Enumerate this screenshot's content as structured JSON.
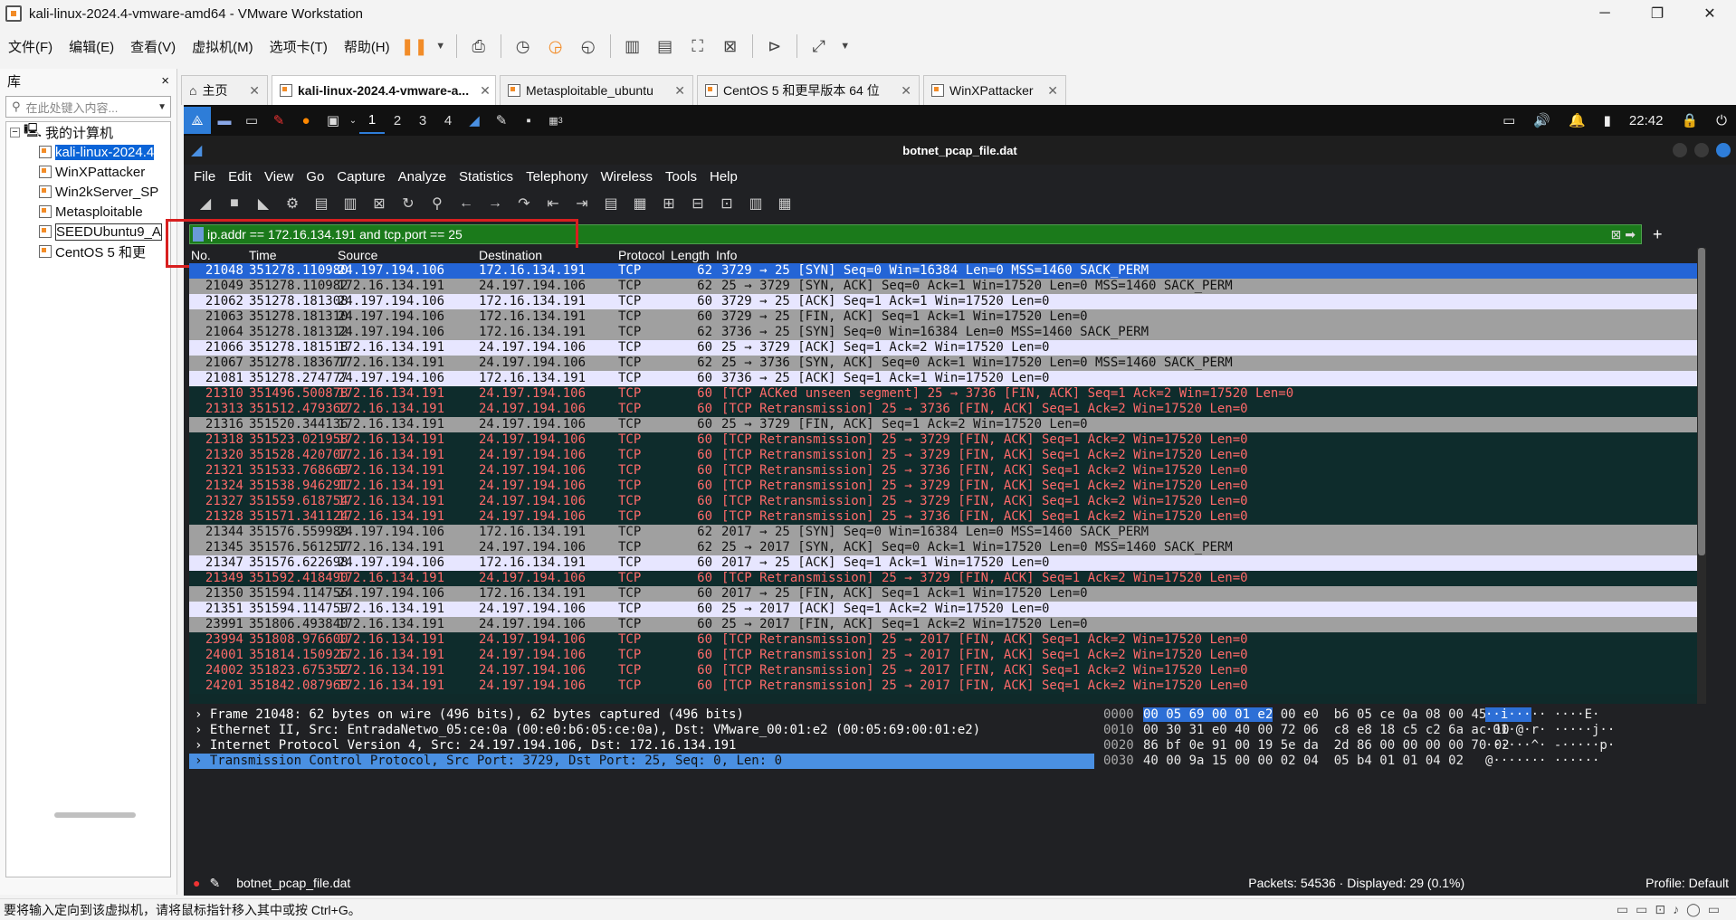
{
  "window": {
    "title": "kali-linux-2024.4-vmware-amd64 - VMware Workstation",
    "min": "─",
    "max": "❐",
    "close": "✕"
  },
  "menubar": {
    "items": [
      "文件(F)",
      "编辑(E)",
      "查看(V)",
      "虚拟机(M)",
      "选项卡(T)",
      "帮助(H)"
    ]
  },
  "library": {
    "title": "库",
    "close": "×",
    "search_placeholder": "在此处键入内容...",
    "root": "我的计算机",
    "vms": [
      "kali-linux-2024.4",
      "WinXPattacker",
      "Win2kServer_SP",
      "Metasploitable",
      "SEEDUbuntu9_A",
      "CentOS 5 和更"
    ]
  },
  "tabs": [
    {
      "label": "主页"
    },
    {
      "label": "kali-linux-2024.4-vmware-a..."
    },
    {
      "label": "Metasploitable_ubuntu"
    },
    {
      "label": "CentOS 5 和更早版本 64 位"
    },
    {
      "label": "WinXPattacker"
    }
  ],
  "kali": {
    "workspaces": [
      "1",
      "2",
      "3",
      "4"
    ],
    "clock": "22:42",
    "badge": "3"
  },
  "wireshark": {
    "title": "botnet_pcap_file.dat",
    "menu": [
      "File",
      "Edit",
      "View",
      "Go",
      "Capture",
      "Analyze",
      "Statistics",
      "Telephony",
      "Wireless",
      "Tools",
      "Help"
    ],
    "filter": "ip.addr == 172.16.134.191 and tcp.port == 25",
    "columns": {
      "no": "No.",
      "time": "Time",
      "source": "Source",
      "destination": "Destination",
      "protocol": "Protocol",
      "length": "Length",
      "info": "Info"
    },
    "packets": [
      {
        "no": "21048",
        "time": "351278.110980",
        "src": "24.197.194.106",
        "dst": "172.16.134.191",
        "proto": "TCP",
        "len": "62",
        "info": "3729 → 25 [SYN] Seq=0 Win=16384 Len=0 MSS=1460 SACK_PERM",
        "style": "sel"
      },
      {
        "no": "21049",
        "time": "351278.110982",
        "src": "172.16.134.191",
        "dst": "24.197.194.106",
        "proto": "TCP",
        "len": "62",
        "info": "25 → 3729 [SYN, ACK] Seq=0 Ack=1 Win=17520 Len=0 MSS=1460 SACK_PERM",
        "style": "syn"
      },
      {
        "no": "21062",
        "time": "351278.181308",
        "src": "24.197.194.106",
        "dst": "172.16.134.191",
        "proto": "TCP",
        "len": "60",
        "info": "3729 → 25 [ACK] Seq=1 Ack=1 Win=17520 Len=0",
        "style": "ack"
      },
      {
        "no": "21063",
        "time": "351278.181310",
        "src": "24.197.194.106",
        "dst": "172.16.134.191",
        "proto": "TCP",
        "len": "60",
        "info": "3729 → 25 [FIN, ACK] Seq=1 Ack=1 Win=17520 Len=0",
        "style": "syn"
      },
      {
        "no": "21064",
        "time": "351278.181312",
        "src": "24.197.194.106",
        "dst": "172.16.134.191",
        "proto": "TCP",
        "len": "62",
        "info": "3736 → 25 [SYN] Seq=0 Win=16384 Len=0 MSS=1460 SACK_PERM",
        "style": "syn"
      },
      {
        "no": "21066",
        "time": "351278.181518",
        "src": "172.16.134.191",
        "dst": "24.197.194.106",
        "proto": "TCP",
        "len": "60",
        "info": "25 → 3729 [ACK] Seq=1 Ack=2 Win=17520 Len=0",
        "style": "ack"
      },
      {
        "no": "21067",
        "time": "351278.183677",
        "src": "172.16.134.191",
        "dst": "24.197.194.106",
        "proto": "TCP",
        "len": "62",
        "info": "25 → 3736 [SYN, ACK] Seq=0 Ack=1 Win=17520 Len=0 MSS=1460 SACK_PERM",
        "style": "syn"
      },
      {
        "no": "21081",
        "time": "351278.274777",
        "src": "24.197.194.106",
        "dst": "172.16.134.191",
        "proto": "TCP",
        "len": "60",
        "info": "3736 → 25 [ACK] Seq=1 Ack=1 Win=17520 Len=0",
        "style": "ack"
      },
      {
        "no": "21310",
        "time": "351496.500878",
        "src": "172.16.134.191",
        "dst": "24.197.194.106",
        "proto": "TCP",
        "len": "60",
        "info": "[TCP ACKed unseen segment] 25 → 3736 [FIN, ACK] Seq=1 Ack=2 Win=17520 Len=0",
        "style": "bad"
      },
      {
        "no": "21313",
        "time": "351512.479362",
        "src": "172.16.134.191",
        "dst": "24.197.194.106",
        "proto": "TCP",
        "len": "60",
        "info": "[TCP Retransmission] 25 → 3736 [FIN, ACK] Seq=1 Ack=2 Win=17520 Len=0",
        "style": "bad"
      },
      {
        "no": "21316",
        "time": "351520.344136",
        "src": "172.16.134.191",
        "dst": "24.197.194.106",
        "proto": "TCP",
        "len": "60",
        "info": "25 → 3729 [FIN, ACK] Seq=1 Ack=2 Win=17520 Len=0",
        "style": "syn"
      },
      {
        "no": "21318",
        "time": "351523.021958",
        "src": "172.16.134.191",
        "dst": "24.197.194.106",
        "proto": "TCP",
        "len": "60",
        "info": "[TCP Retransmission] 25 → 3729 [FIN, ACK] Seq=1 Ack=2 Win=17520 Len=0",
        "style": "bad"
      },
      {
        "no": "21320",
        "time": "351528.420707",
        "src": "172.16.134.191",
        "dst": "24.197.194.106",
        "proto": "TCP",
        "len": "60",
        "info": "[TCP Retransmission] 25 → 3729 [FIN, ACK] Seq=1 Ack=2 Win=17520 Len=0",
        "style": "bad"
      },
      {
        "no": "21321",
        "time": "351533.768669",
        "src": "172.16.134.191",
        "dst": "24.197.194.106",
        "proto": "TCP",
        "len": "60",
        "info": "[TCP Retransmission] 25 → 3736 [FIN, ACK] Seq=1 Ack=2 Win=17520 Len=0",
        "style": "bad"
      },
      {
        "no": "21324",
        "time": "351538.946291",
        "src": "172.16.134.191",
        "dst": "24.197.194.106",
        "proto": "TCP",
        "len": "60",
        "info": "[TCP Retransmission] 25 → 3729 [FIN, ACK] Seq=1 Ack=2 Win=17520 Len=0",
        "style": "bad"
      },
      {
        "no": "21327",
        "time": "351559.618754",
        "src": "172.16.134.191",
        "dst": "24.197.194.106",
        "proto": "TCP",
        "len": "60",
        "info": "[TCP Retransmission] 25 → 3729 [FIN, ACK] Seq=1 Ack=2 Win=17520 Len=0",
        "style": "bad"
      },
      {
        "no": "21328",
        "time": "351571.341124",
        "src": "172.16.134.191",
        "dst": "24.197.194.106",
        "proto": "TCP",
        "len": "60",
        "info": "[TCP Retransmission] 25 → 3736 [FIN, ACK] Seq=1 Ack=2 Win=17520 Len=0",
        "style": "bad"
      },
      {
        "no": "21344",
        "time": "351576.559989",
        "src": "24.197.194.106",
        "dst": "172.16.134.191",
        "proto": "TCP",
        "len": "62",
        "info": "2017 → 25 [SYN] Seq=0 Win=16384 Len=0 MSS=1460 SACK_PERM",
        "style": "syn"
      },
      {
        "no": "21345",
        "time": "351576.561257",
        "src": "172.16.134.191",
        "dst": "24.197.194.106",
        "proto": "TCP",
        "len": "62",
        "info": "25 → 2017 [SYN, ACK] Seq=0 Ack=1 Win=17520 Len=0 MSS=1460 SACK_PERM",
        "style": "syn"
      },
      {
        "no": "21347",
        "time": "351576.622698",
        "src": "24.197.194.106",
        "dst": "172.16.134.191",
        "proto": "TCP",
        "len": "60",
        "info": "2017 → 25 [ACK] Seq=1 Ack=1 Win=17520 Len=0",
        "style": "ack"
      },
      {
        "no": "21349",
        "time": "351592.418490",
        "src": "172.16.134.191",
        "dst": "24.197.194.106",
        "proto": "TCP",
        "len": "60",
        "info": "[TCP Retransmission] 25 → 3729 [FIN, ACK] Seq=1 Ack=2 Win=17520 Len=0",
        "style": "bad"
      },
      {
        "no": "21350",
        "time": "351594.114756",
        "src": "24.197.194.106",
        "dst": "172.16.134.191",
        "proto": "TCP",
        "len": "60",
        "info": "2017 → 25 [FIN, ACK] Seq=1 Ack=1 Win=17520 Len=0",
        "style": "syn"
      },
      {
        "no": "21351",
        "time": "351594.114759",
        "src": "172.16.134.191",
        "dst": "24.197.194.106",
        "proto": "TCP",
        "len": "60",
        "info": "25 → 2017 [ACK] Seq=1 Ack=2 Win=17520 Len=0",
        "style": "ack"
      },
      {
        "no": "23991",
        "time": "351806.493840",
        "src": "172.16.134.191",
        "dst": "24.197.194.106",
        "proto": "TCP",
        "len": "60",
        "info": "25 → 2017 [FIN, ACK] Seq=1 Ack=2 Win=17520 Len=0",
        "style": "syn"
      },
      {
        "no": "23994",
        "time": "351808.976600",
        "src": "172.16.134.191",
        "dst": "24.197.194.106",
        "proto": "TCP",
        "len": "60",
        "info": "[TCP Retransmission] 25 → 2017 [FIN, ACK] Seq=1 Ack=2 Win=17520 Len=0",
        "style": "bad"
      },
      {
        "no": "24001",
        "time": "351814.150926",
        "src": "172.16.134.191",
        "dst": "24.197.194.106",
        "proto": "TCP",
        "len": "60",
        "info": "[TCP Retransmission] 25 → 2017 [FIN, ACK] Seq=1 Ack=2 Win=17520 Len=0",
        "style": "bad"
      },
      {
        "no": "24002",
        "time": "351823.675352",
        "src": "172.16.134.191",
        "dst": "24.197.194.106",
        "proto": "TCP",
        "len": "60",
        "info": "[TCP Retransmission] 25 → 2017 [FIN, ACK] Seq=1 Ack=2 Win=17520 Len=0",
        "style": "bad"
      },
      {
        "no": "24201",
        "time": "351842.087968",
        "src": "172.16.134.191",
        "dst": "24.197.194.106",
        "proto": "TCP",
        "len": "60",
        "info": "[TCP Retransmission] 25 → 2017 [FIN, ACK] Seq=1 Ack=2 Win=17520 Len=0",
        "style": "bad"
      }
    ],
    "details": [
      {
        "text": "Frame 21048: 62 bytes on wire (496 bits), 62 bytes captured (496 bits)",
        "sel": false
      },
      {
        "text": "Ethernet II, Src: EntradaNetwo_05:ce:0a (00:e0:b6:05:ce:0a), Dst: VMware_00:01:e2 (00:05:69:00:01:e2)",
        "sel": false
      },
      {
        "text": "Internet Protocol Version 4, Src: 24.197.194.106, Dst: 172.16.134.191",
        "sel": false
      },
      {
        "text": "Transmission Control Protocol, Src Port: 3729, Dst Port: 25, Seq: 0, Len: 0",
        "sel": true
      }
    ],
    "bytes": [
      {
        "off": "0000",
        "hl": "00 05 69 00 01 e2",
        "hex": "00 e0  b6 05 ce 0a 08 00 45 00",
        "ahl": "··i···",
        "ascii": "·· ····E·"
      },
      {
        "off": "0010",
        "hl": "",
        "hex": "00 30 31 e0 40 00 72 06  c8 e8 18 c5 c2 6a ac 10",
        "ahl": "",
        "ascii": "·01·@·r· ·····j··"
      },
      {
        "off": "0020",
        "hl": "",
        "hex": "86 bf 0e 91 00 19 5e da  2d 86 00 00 00 00 70 02",
        "ahl": "",
        "ascii": "······^· -·····p·"
      },
      {
        "off": "0030",
        "hl": "",
        "hex": "40 00 9a 15 00 00 02 04  05 b4 01 01 04 02",
        "ahl": "",
        "ascii": "@······· ······"
      }
    ],
    "status": {
      "file": "botnet_pcap_file.dat",
      "packets": "Packets: 54536 · Displayed: 29 (0.1%)",
      "profile": "Profile: Default"
    }
  },
  "host_status": "要将输入定向到该虚拟机，请将鼠标指针移入其中或按 Ctrl+G。",
  "colors": {
    "filter_green": "#1b7a1b",
    "selected_blue": "#2465d6",
    "retrans_text": "#ff6a6a",
    "highlight_red": "#d81f1f"
  }
}
